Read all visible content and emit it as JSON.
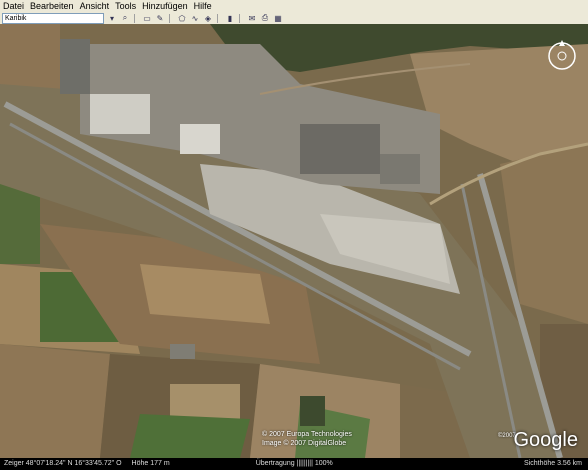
{
  "menu": [
    "Datei",
    "Bearbeiten",
    "Ansicht",
    "Tools",
    "Hinzufügen",
    "Hilfe"
  ],
  "search": {
    "value": "Karibik"
  },
  "toolbar_icons": [
    "grid-icon",
    "placemark-icon",
    "polygon-icon",
    "path-icon",
    "overlay-icon",
    "ruler-icon",
    "email-icon",
    "print-icon",
    "map-icon"
  ],
  "attribution": {
    "line1": "© 2007 Europa Technologies",
    "line2": "Image © 2007 DigitalGlobe",
    "google_year": "©2007",
    "google": "Google"
  },
  "status": {
    "coords": "Zeiger 48°07'18.24\" N    16°33'45.72\" O",
    "elevation": "Höhe 177 m",
    "streaming": "Übertragung ||||||||| 100%",
    "eye_alt": "Sichthöhe 3.56 km"
  },
  "colors": {
    "fields_light": "#a88e66",
    "fields_dark": "#6b5a3e",
    "green": "#4a6b3a",
    "runway": "#9a9a92"
  }
}
